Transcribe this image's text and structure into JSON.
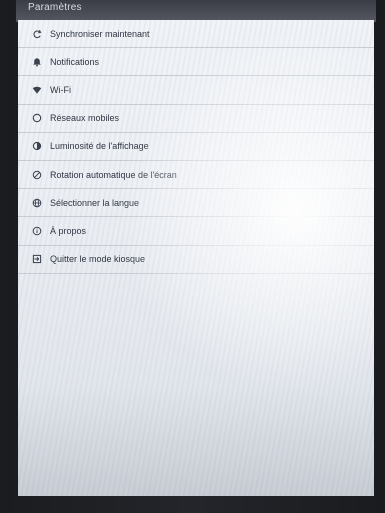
{
  "header": {
    "title": "Paramètres"
  },
  "menu": {
    "items": [
      {
        "label": "Synchroniser maintenant",
        "icon": "sync-icon"
      },
      {
        "label": "Notifications",
        "icon": "bell-icon"
      },
      {
        "label": "Wi-Fi",
        "icon": "wifi-icon"
      },
      {
        "label": "Réseaux mobiles",
        "icon": "signal-icon"
      },
      {
        "label": "Luminosité de l'affichage",
        "icon": "brightness-icon"
      },
      {
        "label": "Rotation automatique de l'écran",
        "icon": "rotation-icon"
      },
      {
        "label": "Sélectionner la langue",
        "icon": "globe-icon"
      },
      {
        "label": "À propos",
        "icon": "info-icon"
      },
      {
        "label": "Quitter le mode kiosque",
        "icon": "exit-icon"
      }
    ]
  },
  "colors": {
    "bezel": "#1b1c20",
    "topbar": "#4a4d56",
    "screen": "#eceff4",
    "text": "#2d3340",
    "divider": "#c9ced6"
  }
}
